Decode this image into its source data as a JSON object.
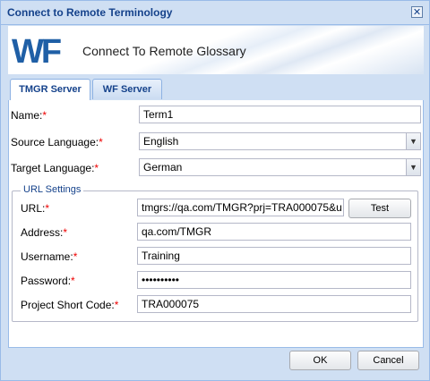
{
  "window": {
    "title": "Connect to Remote Terminology",
    "close_glyph": "✕"
  },
  "banner": {
    "logo_text": "WF",
    "heading": "Connect To Remote Glossary"
  },
  "tabs": [
    {
      "label": "TMGR Server",
      "active": true
    },
    {
      "label": "WF Server",
      "active": false
    }
  ],
  "form": {
    "name": {
      "label": "Name:",
      "value": "Term1"
    },
    "source_language": {
      "label": "Source Language:",
      "value": "English"
    },
    "target_language": {
      "label": "Target Language:",
      "value": "German"
    },
    "required_marker": "*",
    "dropdown_glyph": "▼"
  },
  "url_settings": {
    "legend": "URL Settings",
    "url": {
      "label": "URL:",
      "value": "tmgrs://qa.com/TMGR?prj=TRA000075&u"
    },
    "test_label": "Test",
    "address": {
      "label": "Address:",
      "value": "qa.com/TMGR"
    },
    "username": {
      "label": "Username:",
      "value": "Training"
    },
    "password": {
      "label": "Password:",
      "value": "••••••••••"
    },
    "project_short_code": {
      "label": "Project Short Code:",
      "value": "TRA000075"
    }
  },
  "footer": {
    "ok_label": "OK",
    "cancel_label": "Cancel"
  },
  "colors": {
    "title_blue": "#15428b",
    "frame": "#cfdff3",
    "border": "#99bbe8",
    "required": "#ee0000",
    "logo_blue": "#1f5fa6"
  }
}
